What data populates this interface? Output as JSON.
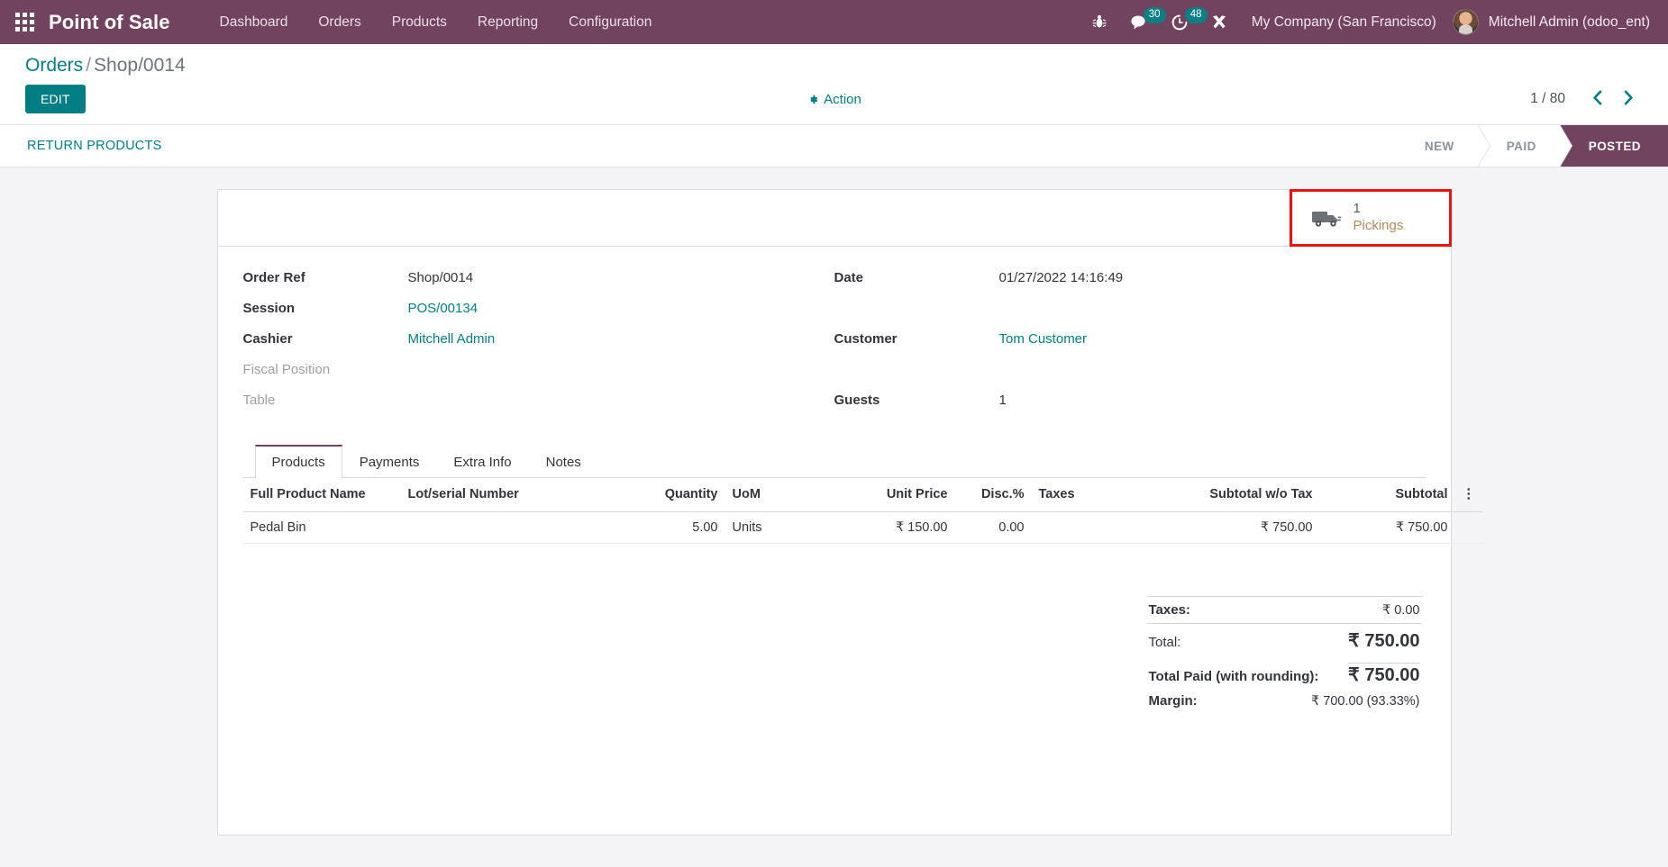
{
  "navbar": {
    "apps_icon": "apps-grid-icon",
    "brand": "Point of Sale",
    "menu_items": [
      {
        "label": "Dashboard"
      },
      {
        "label": "Orders"
      },
      {
        "label": "Products"
      },
      {
        "label": "Reporting"
      },
      {
        "label": "Configuration"
      }
    ],
    "sys_icons": [
      {
        "name": "bug-icon",
        "badge": null
      },
      {
        "name": "messages-icon",
        "badge": "30"
      },
      {
        "name": "activities-clock-icon",
        "badge": "48"
      },
      {
        "name": "developer-tools-icon",
        "badge": null
      }
    ],
    "company": "My Company (San Francisco)",
    "user": "Mitchell Admin (odoo_ent)",
    "accent_bg": "#71435f"
  },
  "control_panel": {
    "breadcrumb_root": "Orders",
    "breadcrumb_sep": "/",
    "breadcrumb_current": "Shop/0014",
    "edit_label": "EDIT",
    "action_label": "Action",
    "action_icon": "gear-icon",
    "pager_text": "1 / 80",
    "prev_icon": "chevron-left-icon",
    "next_icon": "chevron-right-icon",
    "accent": "#017e84"
  },
  "statusbar": {
    "return_products_label": "RETURN PRODUCTS",
    "stages": [
      {
        "label": "NEW",
        "active": false
      },
      {
        "label": "PAID",
        "active": false
      },
      {
        "label": "POSTED",
        "active": true
      }
    ]
  },
  "stat_buttons": [
    {
      "icon": "truck-icon",
      "value": "1",
      "label": "Pickings",
      "highlighted": true,
      "highlight_color": "#ee1111"
    }
  ],
  "form": {
    "left": [
      {
        "label": "Order Ref",
        "value": "Shop/0014",
        "link": false
      },
      {
        "label": "Session",
        "value": "POS/00134",
        "link": true
      },
      {
        "label": "Cashier",
        "value": "Mitchell Admin",
        "link": true
      },
      {
        "label": "Fiscal Position",
        "value": "",
        "link": false,
        "muted": true
      },
      {
        "label": "Table",
        "value": "",
        "link": false,
        "muted": true
      }
    ],
    "right": [
      {
        "label": "Date",
        "value": "01/27/2022 14:16:49",
        "link": false
      },
      {
        "label": "Customer",
        "value": "Tom Customer",
        "link": true
      },
      {
        "label": "Guests",
        "value": "1",
        "link": false
      }
    ]
  },
  "notebook": {
    "tabs": [
      {
        "label": "Products",
        "active": true
      },
      {
        "label": "Payments",
        "active": false
      },
      {
        "label": "Extra Info",
        "active": false
      },
      {
        "label": "Notes",
        "active": false
      }
    ]
  },
  "lines_table": {
    "columns": [
      {
        "label": "Full Product Name",
        "align": "left"
      },
      {
        "label": "Lot/serial Number",
        "align": "left"
      },
      {
        "label": "Quantity",
        "align": "right"
      },
      {
        "label": "UoM",
        "align": "left"
      },
      {
        "label": "Unit Price",
        "align": "right"
      },
      {
        "label": "Disc.%",
        "align": "right"
      },
      {
        "label": "Taxes",
        "align": "left"
      },
      {
        "label": "Subtotal w/o Tax",
        "align": "right"
      },
      {
        "label": "Subtotal",
        "align": "right"
      }
    ],
    "optional_columns_icon": "vertical-dots-icon",
    "rows": [
      {
        "full_product_name": "Pedal Bin",
        "lot_serial_number": "",
        "quantity": "5.00",
        "uom": "Units",
        "unit_price": "₹ 150.00",
        "discount": "0.00",
        "taxes": "",
        "subtotal_wo_tax": "₹ 750.00",
        "subtotal": "₹ 750.00"
      }
    ]
  },
  "totals": [
    {
      "label": "Taxes:",
      "value": "₹ 0.00",
      "style": "regular",
      "bold_label": true,
      "top_border": true
    },
    {
      "label": "Total:",
      "value": "₹ 750.00",
      "style": "big",
      "bold_label": false,
      "top_border": true
    },
    {
      "label": "Total Paid (with rounding):",
      "value": "₹ 750.00",
      "style": "big",
      "bold_label": true,
      "top_border": false
    },
    {
      "label": "Margin:",
      "value": "₹ 700.00 (93.33%)",
      "style": "regular",
      "bold_label": true,
      "top_border": false
    }
  ]
}
